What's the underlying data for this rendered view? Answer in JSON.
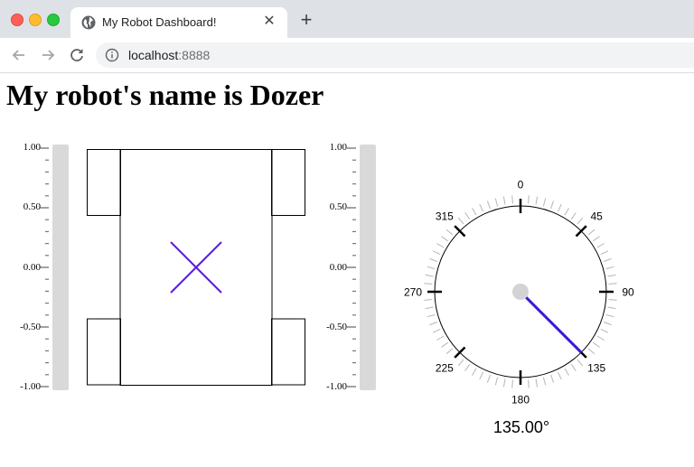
{
  "browser": {
    "tab_title": "My Robot Dashboard!",
    "url_host": "localhost",
    "url_port": ":8888"
  },
  "page": {
    "title": "My robot's name is Dozer"
  },
  "left_slider": {
    "ticks": [
      "1.00",
      "0.50",
      "0.00",
      "-0.50",
      "-1.00"
    ],
    "value": 0.0
  },
  "right_slider": {
    "ticks": [
      "1.00",
      "0.50",
      "0.00",
      "-0.50",
      "-1.00"
    ],
    "value": 0.0
  },
  "compass": {
    "labels": [
      "0",
      "45",
      "90",
      "135",
      "180",
      "225",
      "270",
      "315"
    ],
    "heading": 135,
    "heading_text": "135.00°",
    "needle_color": "#3d16d9",
    "center_color": "#d3d3d3"
  },
  "robot": {
    "marker_color": "#5a1de0"
  }
}
